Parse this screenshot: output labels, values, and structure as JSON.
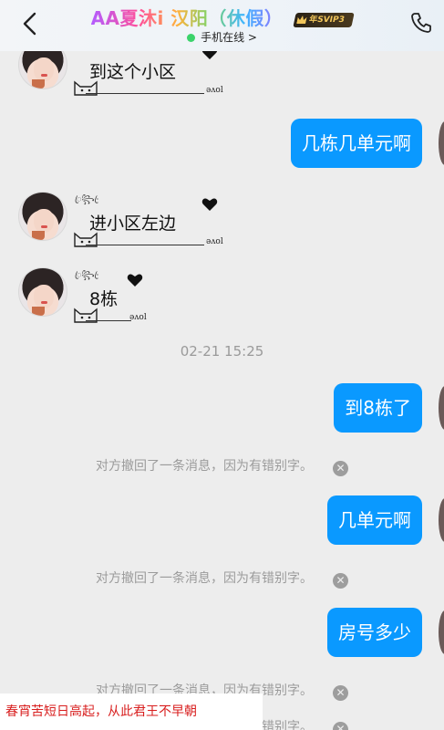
{
  "header": {
    "contact_name": "AA夏沐i 汉阳（休假）",
    "vip_badge": "年SVIP3",
    "status": "手机在线 >",
    "status_color": "#3bd36b",
    "accent": "#0a99ff"
  },
  "icons": {
    "back": "chevron-left-icon",
    "call": "phone-icon"
  },
  "messages": [
    {
      "side": "in",
      "text": "到这个小区"
    },
    {
      "side": "out",
      "text": "几栋几单元啊"
    },
    {
      "side": "in",
      "text": "进小区左边"
    },
    {
      "side": "in",
      "text": "8栋"
    },
    {
      "side": "out",
      "text": "到8栋了"
    },
    {
      "side": "out",
      "text": "几单元啊"
    },
    {
      "side": "out",
      "text": "房号多少"
    }
  ],
  "timestamp": "02-21 15:25",
  "recall_notice": "对方撤回了一条消息，因为有错别字。",
  "watermark": "春宵苦短日高起，从此君王不早朝"
}
